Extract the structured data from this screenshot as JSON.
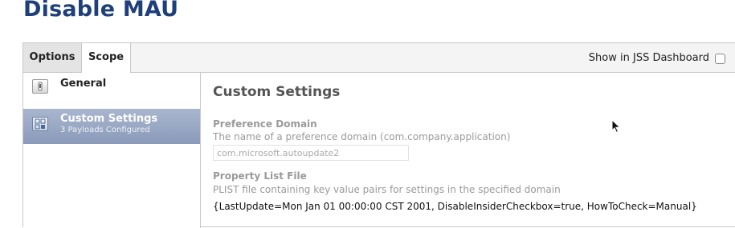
{
  "page": {
    "title": "Disable MAU"
  },
  "tabs": {
    "options_label": "Options",
    "scope_label": "Scope"
  },
  "dashboard": {
    "label": "Show in JSS Dashboard",
    "checked": false
  },
  "sidebar": {
    "items": [
      {
        "label": "General",
        "icon": "switch-icon"
      },
      {
        "label": "Custom Settings",
        "sublabel": "3 Payloads Configured",
        "icon": "custom-settings-icon",
        "selected": true
      }
    ]
  },
  "main": {
    "section_title": "Custom Settings",
    "preference_domain": {
      "label": "Preference Domain",
      "description": "The name of a preference domain (com.company.application)",
      "value": "com.microsoft.autoupdate2"
    },
    "property_list": {
      "label": "Property List File",
      "description": "PLIST file containing key value pairs for settings in the specified domain",
      "value": "{LastUpdate=Mon Jan 01 00:00:00 CST 2001, DisableInsiderCheckbox=true, HowToCheck=Manual}"
    }
  },
  "colors": {
    "title": "#1e3f7a",
    "selected_item": "#9aa8c4"
  }
}
